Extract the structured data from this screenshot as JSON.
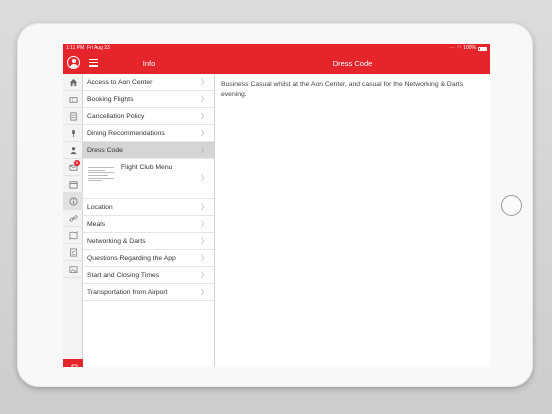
{
  "status": {
    "time": "1:11 PM",
    "date": "Fri Aug 23",
    "battery": "100%"
  },
  "header": {
    "left_title": "Info",
    "main_title": "Dress Code"
  },
  "rail": {
    "icons": [
      "home-icon",
      "ticket-icon",
      "document-icon",
      "microphone-icon",
      "people-icon",
      "mail-icon",
      "calendar-icon",
      "info-icon",
      "link-icon",
      "map-icon",
      "checklist-icon",
      "photo-icon"
    ],
    "mail_badge": "6"
  },
  "list": {
    "items": [
      {
        "label": "Access to Aon Center"
      },
      {
        "label": "Booking Flights"
      },
      {
        "label": "Cancellation Policy"
      },
      {
        "label": "Dining Recommendations"
      },
      {
        "label": "Dress Code"
      },
      {
        "label": "Flight Club Menu"
      },
      {
        "label": "Location"
      },
      {
        "label": "Meals"
      },
      {
        "label": "Networking & Darts"
      },
      {
        "label": "Questions Regarding the App"
      },
      {
        "label": "Start and Closing Times"
      },
      {
        "label": "Transportation from Airport"
      }
    ],
    "selected_index": 4
  },
  "content": {
    "text": "Business Casual whilst at the Aon Center, and casual for the Networking & Darts evening."
  },
  "colors": {
    "accent": "#e5242b",
    "selected": "#d5d5d5"
  }
}
